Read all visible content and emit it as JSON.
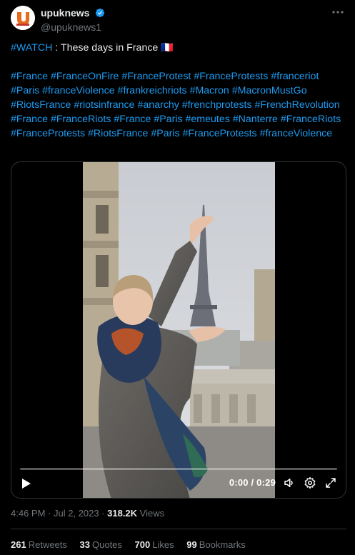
{
  "author": {
    "display_name": "upuknews",
    "handle": "@upuknews1",
    "verified": true,
    "avatar_icon": "upuk-logo-icon"
  },
  "tweet": {
    "watch_tag": "#WATCH",
    "headline": " : These days in France 🇫🇷",
    "hashtags": [
      "#France",
      "#FranceOnFire",
      "#FranceProtest",
      "#FranceProtests",
      "#franceriot",
      "#Paris",
      "#franceViolence",
      "#frankreichriots",
      "#Macron",
      "#MacronMustGo",
      "#RiotsFrance",
      "#riotsinfrance",
      "#anarchy",
      "#frenchprotests",
      "#FrenchRevolution",
      "#France",
      "#FranceRiots",
      "#France",
      "#Paris",
      "#emeutes",
      "#Nanterre",
      "#FranceRiots",
      "#FranceProtests",
      "#RiotsFrance",
      "#Paris",
      "#FranceProtests",
      "#franceViolence"
    ]
  },
  "video": {
    "time_label": "0:00 / 0:29",
    "progress_fraction": 0.0
  },
  "meta": {
    "timestamp": "4:46 PM · Jul 2, 2023 · ",
    "views_count": "318.2K",
    "views_label": " Views"
  },
  "stats": [
    {
      "count": "261",
      "label": "Retweets"
    },
    {
      "count": "33",
      "label": "Quotes"
    },
    {
      "count": "700",
      "label": "Likes"
    },
    {
      "count": "99",
      "label": "Bookmarks"
    }
  ],
  "colors": {
    "background": "#000000",
    "text": "#e7e9ea",
    "muted": "#71767b",
    "accent": "#1d9bf0"
  }
}
